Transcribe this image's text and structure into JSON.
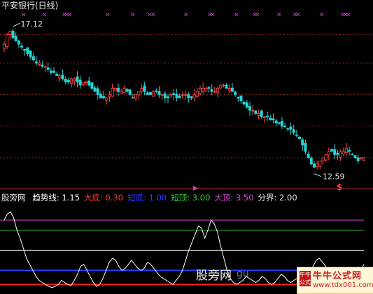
{
  "title": "平安银行(日线)",
  "price_labels": {
    "high": "17.12",
    "low": "12.59"
  },
  "signal_marker": "$",
  "indicator_bar": {
    "name": "股旁网",
    "items": [
      {
        "label": "趋势线:",
        "value": "1.15",
        "color": "#ffffff"
      },
      {
        "label": "大底:",
        "value": "0.30",
        "color": "#ff3c3c"
      },
      {
        "label": "短底:",
        "value": "1.00",
        "color": "#2e3cff"
      },
      {
        "label": "短顶:",
        "value": "3.00",
        "color": "#3cd23c"
      },
      {
        "label": "大顶:",
        "value": "3.50",
        "color": "#d246d2"
      },
      {
        "label": "分界:",
        "value": "2.00",
        "color": "#e6e6e6"
      }
    ]
  },
  "watermark": {
    "text": "股旁网",
    "url_part": "gu"
  },
  "brand": {
    "name": "牛牛公式网",
    "url": "www.tdx001.com",
    "seal": "牛牛公式"
  },
  "colors": {
    "up": "#ff4a4a",
    "down": "#28d2d2",
    "cross": "#d23cd2",
    "trend": "#ffffff"
  },
  "chart_data": [
    {
      "type": "candlestick",
      "title": "平安银行(日线)",
      "ylim": [
        12.2,
        17.6
      ],
      "annotations": [
        {
          "text": "17.12",
          "at_index": 3
        },
        {
          "text": "12.59",
          "at_index": 106
        }
      ],
      "closes": [
        16.6,
        16.9,
        17.0,
        16.8,
        16.7,
        16.6,
        16.5,
        16.4,
        16.3,
        16.2,
        16.1,
        16.0,
        16.0,
        15.9,
        15.9,
        15.8,
        15.7,
        15.7,
        15.6,
        15.6,
        15.5,
        15.4,
        15.4,
        15.5,
        15.5,
        15.4,
        15.3,
        15.4,
        15.4,
        15.3,
        15.2,
        15.1,
        15.0,
        14.9,
        14.9,
        14.9,
        15.0,
        15.2,
        15.2,
        15.1,
        15.1,
        15.2,
        15.1,
        15.0,
        14.9,
        15.0,
        15.1,
        15.2,
        15.1,
        15.0,
        15.0,
        15.1,
        15.1,
        15.0,
        15.0,
        14.9,
        14.9,
        15.0,
        15.0,
        14.9,
        14.9,
        15.0,
        15.0,
        14.9,
        14.9,
        15.0,
        15.1,
        15.2,
        15.2,
        15.2,
        15.2,
        15.1,
        15.1,
        15.2,
        15.3,
        15.3,
        15.2,
        15.2,
        15.1,
        15.0,
        14.9,
        14.8,
        14.7,
        14.6,
        14.5,
        14.5,
        14.4,
        14.4,
        14.3,
        14.3,
        14.3,
        14.2,
        14.2,
        14.1,
        14.1,
        14.0,
        14.0,
        13.9,
        13.9,
        13.8,
        13.7,
        13.6,
        13.4,
        13.2,
        13.0,
        12.8,
        12.7,
        12.8,
        12.9,
        13.0,
        13.1,
        13.2,
        13.2,
        13.1,
        13.1,
        13.2,
        13.2,
        13.3,
        13.2,
        13.1,
        13.0,
        12.9,
        13.0,
        13.0
      ],
      "cross_markers_count": 22
    },
    {
      "type": "line",
      "title": "股旁网",
      "ylim": [
        0.0,
        4.3
      ],
      "series": [
        {
          "name": "趋势线",
          "values": [
            3.5,
            3.8,
            3.9,
            3.6,
            3.0,
            2.6,
            2.1,
            1.6,
            1.3,
            1.0,
            0.7,
            0.5,
            0.4,
            0.3,
            0.2,
            0.15,
            0.2,
            0.3,
            0.5,
            0.4,
            0.3,
            0.25,
            0.5,
            0.8,
            1.2,
            1.3,
            1.0,
            0.7,
            0.4,
            0.2,
            0.3,
            0.6,
            1.0,
            1.4,
            1.6,
            1.5,
            1.2,
            1.0,
            1.1,
            1.3,
            1.5,
            1.3,
            1.1,
            1.0,
            1.1,
            1.4,
            1.3,
            1.1,
            0.9,
            0.7,
            0.6,
            0.5,
            0.4,
            0.3,
            0.5,
            0.7,
            1.0,
            1.5,
            2.0,
            2.4,
            2.8,
            3.2,
            3.1,
            2.6,
            3.0,
            3.5,
            3.3,
            2.9,
            2.2,
            1.6,
            1.0,
            0.6,
            0.4,
            0.3,
            0.4,
            0.5,
            0.7,
            0.6,
            0.5,
            0.4,
            0.5,
            0.7,
            0.6,
            0.4,
            0.3,
            0.4,
            0.6,
            0.8,
            0.7,
            0.5,
            0.4,
            0.5,
            0.6,
            0.5,
            0.4,
            0.5,
            0.8,
            1.2,
            1.5,
            1.6,
            1.4,
            1.2,
            1.0,
            0.8,
            0.9,
            1.1,
            1.0,
            0.8,
            0.6,
            0.5,
            0.6,
            0.8,
            1.0,
            1.3
          ]
        },
        {
          "name": "大底",
          "values": [
            0.3
          ]
        },
        {
          "name": "短底",
          "values": [
            1.0
          ]
        },
        {
          "name": "短顶",
          "values": [
            3.0
          ]
        },
        {
          "name": "大顶",
          "values": [
            3.5
          ]
        },
        {
          "name": "分界",
          "values": [
            2.0
          ]
        }
      ]
    }
  ]
}
